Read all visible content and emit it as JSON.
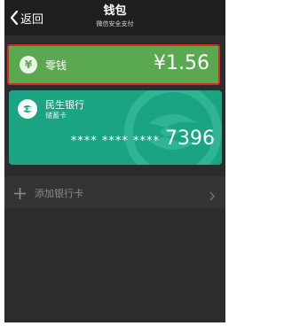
{
  "nav": {
    "back_label": "返回",
    "title": "钱包",
    "subtitle": "微信安全支付"
  },
  "change": {
    "icon": "yen-icon",
    "symbol": "¥",
    "label": "零钱",
    "amount": "¥1.56"
  },
  "bank_card": {
    "icon": "cmbc-bank-logo",
    "bank_name": "民生银行",
    "card_type": "储蓄卡",
    "masked_number": "**** **** ****",
    "last_four": "7396"
  },
  "add_card": {
    "label": "添加银行卡"
  },
  "colors": {
    "background": "#2c2c2e",
    "change_card": "#5aa84f",
    "change_highlight_border": "#d62b25",
    "bank_card": "#1aa483"
  }
}
